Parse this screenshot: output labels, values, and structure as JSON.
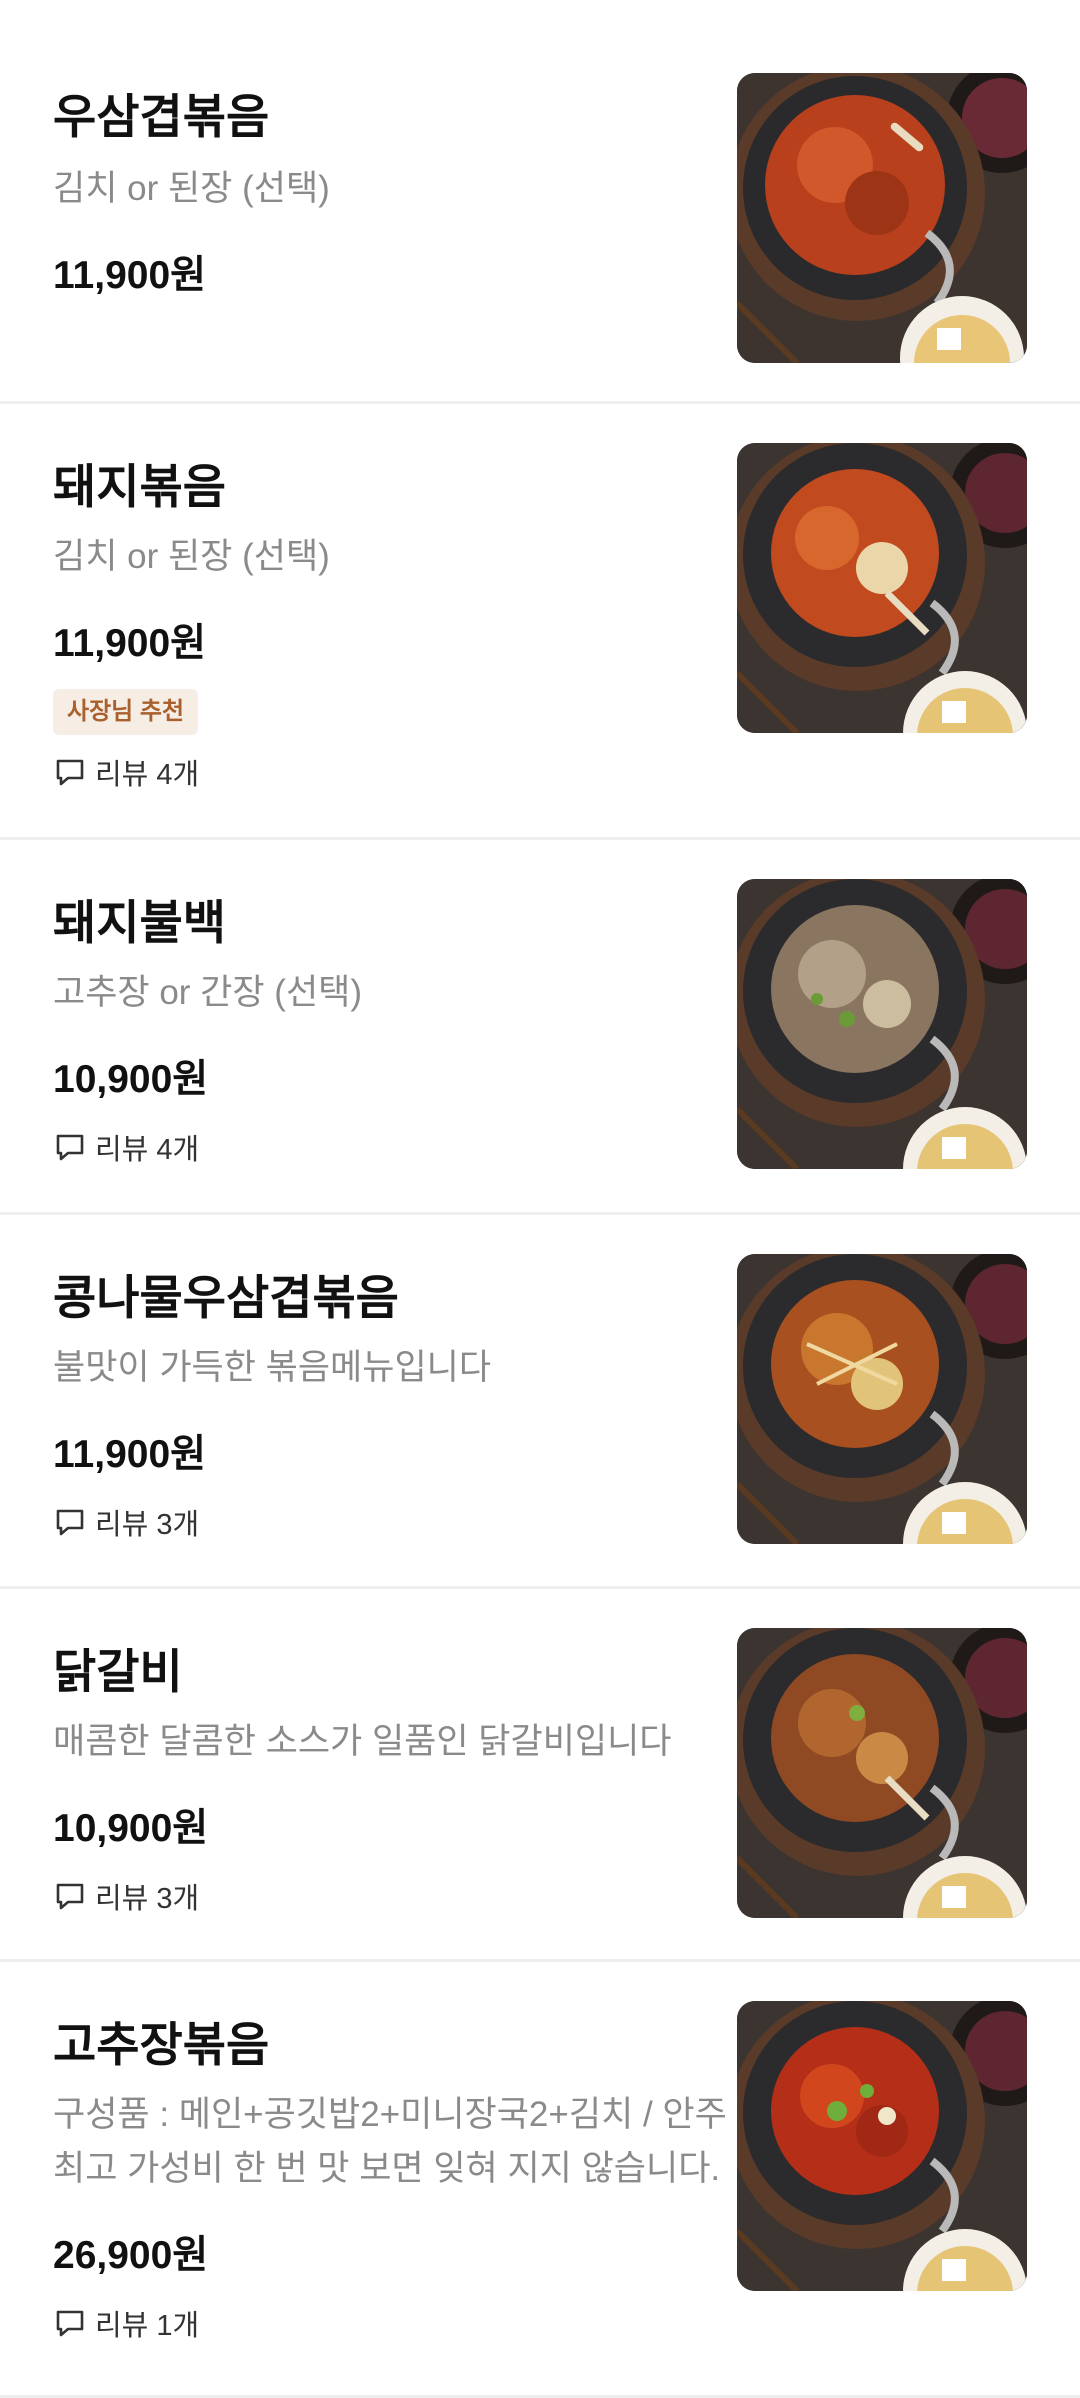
{
  "menu": {
    "items": [
      {
        "name": "우삼겹볶음",
        "desc_lines": [
          "김치 or 된장 (선택)"
        ],
        "price": "11,900원",
        "food_image": "spicy-beef-stirfry-pan-photo"
      },
      {
        "name": "돼지볶음",
        "desc_lines": [
          "김치 or 된장 (선택)"
        ],
        "price": "11,900원",
        "badge": "사장님 추천",
        "review": "리뷰 4개",
        "food_image": "spicy-pork-stirfry-pan-photo"
      },
      {
        "name": "돼지불백",
        "desc_lines": [
          "고추장 or 간장 (선택)"
        ],
        "price": "10,900원",
        "review": "리뷰 4개",
        "food_image": "soy-pork-bulbaek-pan-photo"
      },
      {
        "name": "콩나물우삼겹볶음",
        "desc_lines": [
          "불맛이 가득한 볶음메뉴입니다"
        ],
        "price": "11,900원",
        "review": "리뷰 3개",
        "food_image": "beansprout-beef-stirfry-pan-photo"
      },
      {
        "name": "닭갈비",
        "desc_lines": [
          "매콤한 달콤한 소스가 일품인 닭갈비입니다"
        ],
        "price": "10,900원",
        "review": "리뷰 3개",
        "food_image": "dakgalbi-pan-photo"
      },
      {
        "name": "고추장볶음",
        "desc_lines": [
          "구성품 : 메인+공깃밥2+미니장국2+김치 / 안주",
          "최고 가성비 한 번 맛 보면 잊혀 지지 않습니다."
        ],
        "price": "26,900원",
        "review": "리뷰 1개",
        "food_image": "gochujang-stirfry-pan-photo"
      }
    ]
  },
  "icons": {
    "review": "speech-bubble-icon"
  },
  "colors": {
    "badge_bg": "#f6ede5",
    "badge_text": "#a9602d",
    "desc_text": "#8a8a8a",
    "divider": "#eeeeee"
  }
}
